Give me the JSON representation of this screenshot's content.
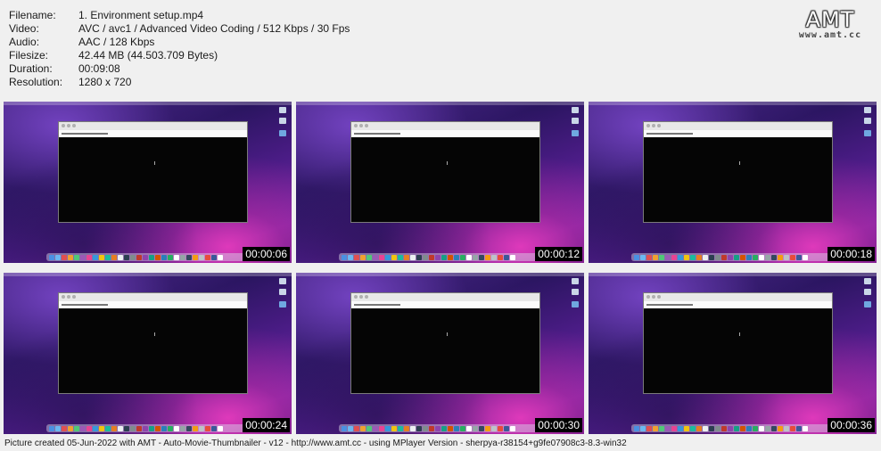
{
  "info": [
    {
      "key": "Filename:",
      "value": "1. Environment setup.mp4"
    },
    {
      "key": "Video:",
      "value": "AVC / avc1 / Advanced Video Coding / 512 Kbps / 30 Fps"
    },
    {
      "key": "Audio:",
      "value": "AAC / 128 Kbps"
    },
    {
      "key": "Filesize:",
      "value": "42.44 MB (44.503.709 Bytes)"
    },
    {
      "key": "Duration:",
      "value": "00:09:08"
    },
    {
      "key": "Resolution:",
      "value": "1280 x 720"
    }
  ],
  "logo": {
    "main": "AMT",
    "sub": "www.amt.cc"
  },
  "thumbnails": [
    {
      "timestamp": "00:00:06"
    },
    {
      "timestamp": "00:00:12"
    },
    {
      "timestamp": "00:00:18"
    },
    {
      "timestamp": "00:00:24"
    },
    {
      "timestamp": "00:00:30"
    },
    {
      "timestamp": "00:00:36"
    }
  ],
  "dock_colors": [
    "#4a90e2",
    "#6bb8f0",
    "#e05050",
    "#f0a030",
    "#50c878",
    "#9b59b6",
    "#e84393",
    "#3498db",
    "#f1c40f",
    "#1abc9c",
    "#e67e22",
    "#ecf0f1",
    "#2c3e50",
    "#7f8c8d",
    "#c0392b",
    "#8e44ad",
    "#16a085",
    "#d35400",
    "#2980b9",
    "#27ae60",
    "#ffffff",
    "#95a5a6",
    "#34495e",
    "#f39c12",
    "#bdc3c7",
    "#e74c3c",
    "#3b5998",
    "#ffffff"
  ],
  "footer": "Picture created 05-Jun-2022 with AMT - Auto-Movie-Thumbnailer - v12 - http://www.amt.cc - using MPlayer Version - sherpya-r38154+g9fe07908c3-8.3-win32"
}
